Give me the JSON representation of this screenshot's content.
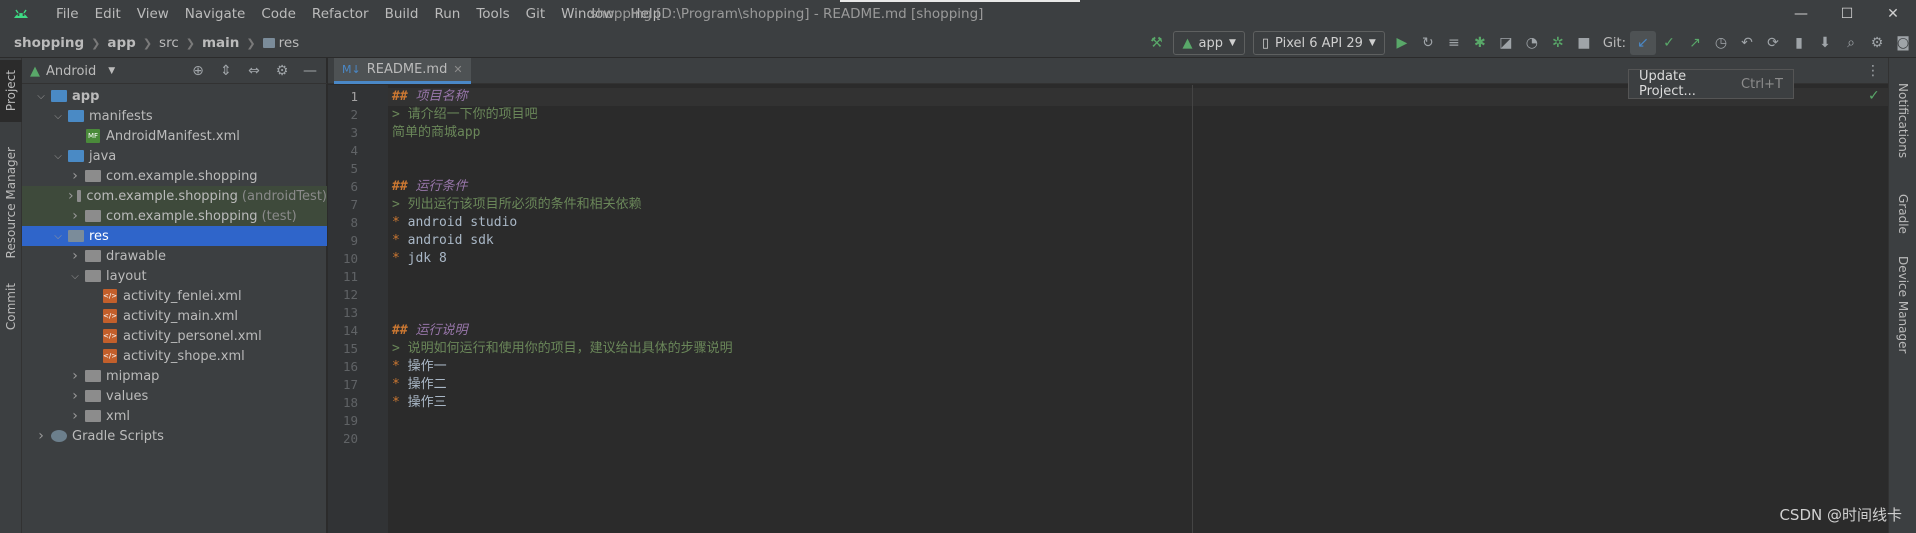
{
  "window": {
    "title": "shopping [D:\\Program\\shopping] - README.md [shopping]",
    "controls": [
      "—",
      "☐",
      "✕"
    ]
  },
  "menu": [
    "File",
    "Edit",
    "View",
    "Navigate",
    "Code",
    "Refactor",
    "Build",
    "Run",
    "Tools",
    "Git",
    "Window",
    "Help"
  ],
  "breadcrumb": [
    "shopping",
    "app",
    "src",
    "main",
    "res"
  ],
  "toolbar": {
    "run_config": "app",
    "device": "Pixel 6 API 29",
    "git_label": "Git:"
  },
  "left_strip": {
    "tabs": [
      "Project",
      "Resource Manager",
      "Commit"
    ]
  },
  "project_panel": {
    "view_selector": "Android",
    "tree": [
      {
        "label": "app",
        "level": 0,
        "expanded": true,
        "kind": "module"
      },
      {
        "label": "manifests",
        "level": 1,
        "expanded": true,
        "kind": "folder"
      },
      {
        "label": "AndroidManifest.xml",
        "level": 2,
        "kind": "manifest"
      },
      {
        "label": "java",
        "level": 1,
        "expanded": true,
        "kind": "folder"
      },
      {
        "label": "com.example.shopping",
        "level": 2,
        "kind": "package"
      },
      {
        "label": "com.example.shopping",
        "suffix": "(androidTest)",
        "level": 2,
        "kind": "package",
        "highlight": true
      },
      {
        "label": "com.example.shopping",
        "suffix": "(test)",
        "level": 2,
        "kind": "package",
        "highlight": true
      },
      {
        "label": "res",
        "level": 1,
        "expanded": true,
        "kind": "res",
        "selected": true
      },
      {
        "label": "drawable",
        "level": 2,
        "kind": "package"
      },
      {
        "label": "layout",
        "level": 2,
        "expanded": true,
        "kind": "package"
      },
      {
        "label": "activity_fenlei.xml",
        "level": 3,
        "kind": "xml"
      },
      {
        "label": "activity_main.xml",
        "level": 3,
        "kind": "xml"
      },
      {
        "label": "activity_personel.xml",
        "level": 3,
        "kind": "xml"
      },
      {
        "label": "activity_shope.xml",
        "level": 3,
        "kind": "xml"
      },
      {
        "label": "mipmap",
        "level": 2,
        "kind": "package"
      },
      {
        "label": "values",
        "level": 2,
        "kind": "package"
      },
      {
        "label": "xml",
        "level": 2,
        "kind": "package"
      },
      {
        "label": "Gradle Scripts",
        "level": 0,
        "kind": "gradle"
      }
    ]
  },
  "editor": {
    "tab": "README.md",
    "lines": [
      {
        "n": "1",
        "parts": [
          [
            "h2",
            "## "
          ],
          [
            "h2t",
            "项目名称"
          ]
        ]
      },
      {
        "n": "2",
        "parts": [
          [
            "quote",
            "> 请介绍一下你的项目吧"
          ]
        ]
      },
      {
        "n": "3",
        "parts": [
          [
            "grn",
            "简单的商城app"
          ]
        ]
      },
      {
        "n": "4",
        "parts": []
      },
      {
        "n": "5",
        "parts": []
      },
      {
        "n": "6",
        "parts": [
          [
            "h2",
            "## "
          ],
          [
            "h2t",
            "运行条件"
          ]
        ]
      },
      {
        "n": "7",
        "parts": [
          [
            "quote",
            "> 列出运行该项目所必须的条件和相关依赖"
          ]
        ]
      },
      {
        "n": "8",
        "parts": [
          [
            "bul",
            "* "
          ],
          [
            "txt",
            "android studio"
          ]
        ]
      },
      {
        "n": "9",
        "parts": [
          [
            "bul",
            "* "
          ],
          [
            "txt",
            "android sdk"
          ]
        ]
      },
      {
        "n": "10",
        "parts": [
          [
            "bul",
            "* "
          ],
          [
            "txt",
            "jdk 8"
          ]
        ]
      },
      {
        "n": "11",
        "parts": []
      },
      {
        "n": "12",
        "parts": []
      },
      {
        "n": "13",
        "parts": []
      },
      {
        "n": "14",
        "parts": [
          [
            "h2",
            "## "
          ],
          [
            "h2t",
            "运行说明"
          ]
        ]
      },
      {
        "n": "15",
        "parts": [
          [
            "quote",
            "> 说明如何运行和使用你的项目，建议给出具体的步骤说明"
          ]
        ]
      },
      {
        "n": "16",
        "parts": [
          [
            "bul",
            "* "
          ],
          [
            "txt",
            "操作一"
          ]
        ]
      },
      {
        "n": "17",
        "parts": [
          [
            "bul",
            "* "
          ],
          [
            "txt",
            "操作二"
          ]
        ]
      },
      {
        "n": "18",
        "parts": [
          [
            "bul",
            "* "
          ],
          [
            "txt",
            "操作三"
          ]
        ]
      },
      {
        "n": "19",
        "parts": []
      },
      {
        "n": "20",
        "parts": []
      }
    ]
  },
  "right_strip": {
    "tabs": [
      "Notifications",
      "Gradle",
      "Device Manager"
    ]
  },
  "popup": {
    "label": "Update Project...",
    "shortcut": "Ctrl+T"
  },
  "watermark": "CSDN @时间线卡",
  "colors": {
    "accent": "#2f65ca",
    "android_green": "#3ddc84",
    "run_green": "#59a869"
  }
}
